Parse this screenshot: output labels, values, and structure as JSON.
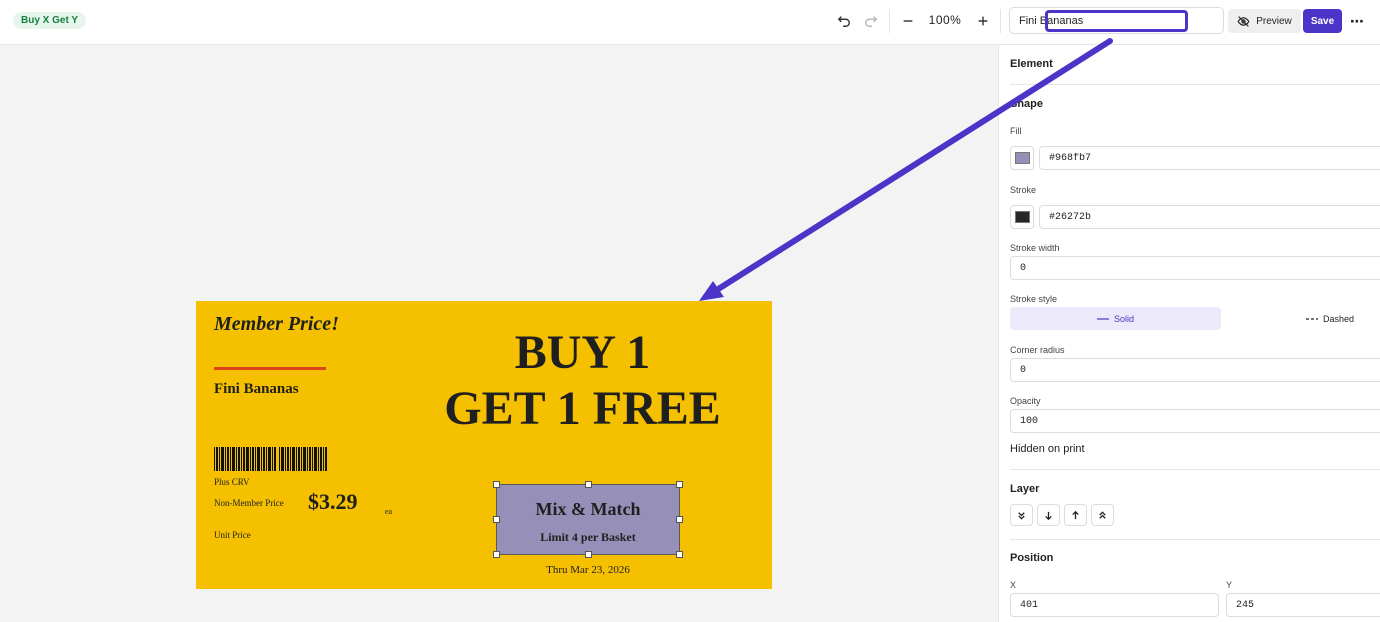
{
  "topbar": {
    "tag": "Buy X Get Y",
    "zoom": "100%",
    "name_value": "Fini Bananas",
    "preview_label": "Preview",
    "save_label": "Save",
    "more_label": "⋯"
  },
  "label": {
    "member_text": "Member Price!",
    "product_name": "Fini Bananas",
    "plus_crv": "Plus CRV",
    "non_member": "Non-Member Price",
    "price": "$3.29",
    "ea": "ea",
    "unit_price": "Unit Price",
    "headline_1": "BUY 1",
    "headline_2": "GET 1 FREE",
    "mm_title": "Mix & Match",
    "mm_sub": "Limit 4 per Basket",
    "thru": "Thru Mar 23, 2026",
    "background_color": "#f5c000",
    "accent_line_color": "#e0421b"
  },
  "panel": {
    "element_heading": "Element",
    "shape_heading": "Shape",
    "fill_label": "Fill",
    "fill_value": "#968fb7",
    "stroke_label": "Stroke",
    "stroke_value": "#26272b",
    "stroke_width_label": "Stroke width",
    "stroke_width_value": "0",
    "stroke_style_label": "Stroke style",
    "solid_label": "Solid",
    "dashed_label": "Dashed",
    "corner_label": "Corner radius",
    "corner_value": "0",
    "opacity_label": "Opacity",
    "opacity_value": "100",
    "hidden_label": "Hidden on print",
    "layer_heading": "Layer",
    "position_heading": "Position",
    "x_label": "X",
    "x_value": "401",
    "y_label": "Y",
    "y_value": "245"
  },
  "colors": {
    "accent": "#4b34c8",
    "tag_text": "#15803d",
    "tag_bg": "#e7f6ec",
    "canvas_bg": "#f3f3f3"
  },
  "icons": [
    "undo-icon",
    "redo-icon",
    "zoom-out-icon",
    "zoom-in-icon",
    "eye-off-icon",
    "more-icon",
    "send-to-back-icon",
    "send-backward-icon",
    "bring-forward-icon",
    "bring-to-front-icon",
    "barcode-icon"
  ]
}
